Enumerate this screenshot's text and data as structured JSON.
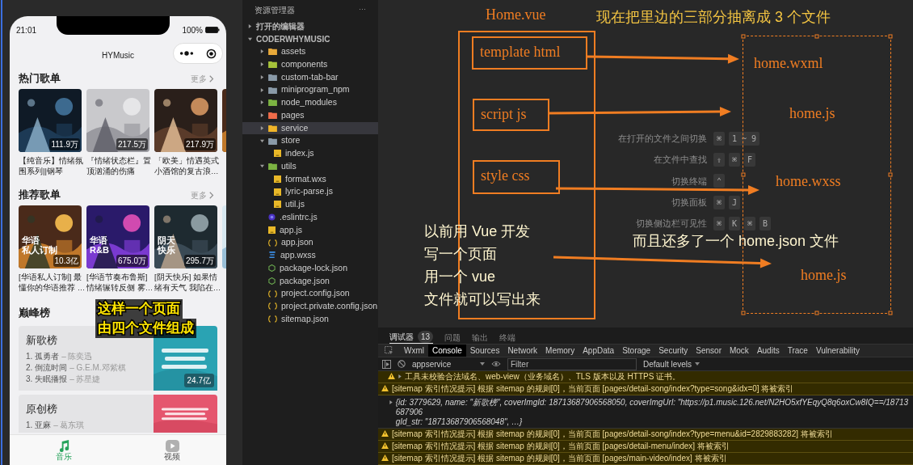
{
  "phone": {
    "time": "21:01",
    "battery": "100%",
    "title": "HYMusic",
    "hot": {
      "title": "热门歌单",
      "more": "更多",
      "items": [
        {
          "count": "111.9万",
          "name": [
            "【纯音乐】情绪氛",
            "围系列||钢琴"
          ]
        },
        {
          "count": "217.5万",
          "name": [
            "『情绪状态栏』置",
            "顶汹涌的伤痛"
          ]
        },
        {
          "count": "217.9万",
          "name": [
            "「欧美」情遇英式",
            "小酒馆的复古浪…"
          ]
        }
      ]
    },
    "recommend": {
      "title": "推荐歌单",
      "more": "更多",
      "items": [
        {
          "tag": [
            "华语",
            "私人订制"
          ],
          "count": "10.3亿",
          "name": [
            "[华语私人订制] 最",
            "懂你的华语推荐 …"
          ]
        },
        {
          "tag": [
            "华语",
            "R&B"
          ],
          "count": "675.0万",
          "name": [
            "[华语节奏布鲁斯]",
            "情绪辗转反侧 雾…"
          ]
        },
        {
          "tag": [
            "阴天",
            "快乐"
          ],
          "count": "295.7万",
          "name": [
            "[阴天快乐] 如果情",
            "绪有天气 我陷在…"
          ]
        }
      ]
    },
    "ranking_title": "巅峰榜",
    "rankings": [
      {
        "name": "新歌榜",
        "count": "24.7亿",
        "songs": [
          {
            "title": "1. 孤勇者",
            "artist": "– 陈奕迅"
          },
          {
            "title": "2. 倒流时间",
            "artist": "– G.E.M.邓紫棋"
          },
          {
            "title": "3. 失眠播报",
            "artist": "– 苏星婕"
          }
        ]
      },
      {
        "name": "原创榜",
        "songs": [
          {
            "title": "1. 亚麻",
            "artist": "– 葛东琪"
          }
        ]
      }
    ],
    "tabbar": [
      {
        "label": "音乐",
        "selected": true
      },
      {
        "label": "视频",
        "selected": false
      }
    ],
    "caption": [
      "这样一个页面",
      "由四个文件组成"
    ]
  },
  "explorer": {
    "title": "资源管理器",
    "menu": "···",
    "sections": [
      {
        "label": "打开的编辑器",
        "expanded": false
      },
      {
        "label": "CODERWHYMUSIC",
        "expanded": true,
        "children": [
          {
            "name": "assets",
            "kind": "folder",
            "color": "#e8a93a",
            "expanded": false,
            "selected": false
          },
          {
            "name": "components",
            "kind": "folder",
            "color": "#a6c23a",
            "expanded": false,
            "selected": false
          },
          {
            "name": "custom-tab-bar",
            "kind": "folder",
            "color": "#8a9aa8",
            "expanded": false,
            "selected": false
          },
          {
            "name": "miniprogram_npm",
            "kind": "folder",
            "color": "#8a9aa8",
            "expanded": false,
            "selected": false
          },
          {
            "name": "node_modules",
            "kind": "folder",
            "color": "#7cb342",
            "expanded": false,
            "selected": false
          },
          {
            "name": "pages",
            "kind": "folder",
            "color": "#ef6c4a",
            "expanded": false,
            "selected": false
          },
          {
            "name": "service",
            "kind": "folder",
            "color": "#f0b429",
            "expanded": false,
            "selected": true
          },
          {
            "name": "store",
            "kind": "folder",
            "color": "#8a9aa8",
            "expanded": true,
            "selected": false,
            "children": [
              {
                "name": "index.js",
                "kind": "js",
                "selected": false
              }
            ]
          },
          {
            "name": "utils",
            "kind": "folder",
            "color": "#7cb342",
            "expanded": true,
            "selected": false,
            "children": [
              {
                "name": "format.wxs",
                "kind": "js",
                "selected": false
              },
              {
                "name": "lyric-parse.js",
                "kind": "js",
                "selected": false
              },
              {
                "name": "util.js",
                "kind": "js",
                "selected": false
              }
            ]
          },
          {
            "name": ".eslintrc.js",
            "kind": "eslint",
            "selected": false
          },
          {
            "name": "app.js",
            "kind": "js",
            "selected": false
          },
          {
            "name": "app.json",
            "kind": "json",
            "selected": false
          },
          {
            "name": "app.wxss",
            "kind": "css",
            "selected": false
          },
          {
            "name": "package-lock.json",
            "kind": "npm",
            "selected": false
          },
          {
            "name": "package.json",
            "kind": "npm",
            "selected": false
          },
          {
            "name": "project.config.json",
            "kind": "json",
            "selected": false
          },
          {
            "name": "project.private.config.json",
            "kind": "json",
            "selected": false
          },
          {
            "name": "sitemap.json",
            "kind": "json",
            "selected": false
          }
        ]
      }
    ]
  },
  "canvas": {
    "file_title": "Home.vue",
    "heading": "现在把里边的三部分抽离成 3 个文件",
    "hints": [
      {
        "label": "在打开的文件之间切换",
        "keys": [
          "⌘",
          "1 ~ 9"
        ]
      },
      {
        "label": "在文件中查找",
        "keys": [
          "⇧",
          "⌘",
          "F"
        ]
      },
      {
        "label": "切换终端",
        "keys": [
          "⌃"
        ]
      },
      {
        "label": "切换面板",
        "keys": [
          "⌘",
          "J"
        ]
      },
      {
        "label": "切换侧边栏可见性",
        "keys": [
          "⌘",
          "K",
          "⌘",
          "B"
        ]
      }
    ],
    "sources": [
      "template html",
      "script js",
      "style css"
    ],
    "targets": [
      "home.wxml",
      "home.js",
      "home.wxss",
      "home.js"
    ],
    "note": [
      "以前用 Vue 开发",
      "写一个页面",
      "用一个 vue",
      "文件就可以写出来"
    ],
    "extra_note": "而且还多了一个 home.json 文件"
  },
  "console": {
    "panel_tabs": [
      {
        "label": "调试器",
        "badge": "13",
        "selected": true
      },
      {
        "label": "问题",
        "selected": false
      },
      {
        "label": "输出",
        "selected": false
      },
      {
        "label": "终端",
        "selected": false
      }
    ],
    "tools": [
      {
        "label": "Wxml",
        "selected": false
      },
      {
        "label": "Console",
        "selected": true
      },
      {
        "label": "Sources",
        "selected": false
      },
      {
        "label": "Network",
        "selected": false
      },
      {
        "label": "Memory",
        "selected": false
      },
      {
        "label": "AppData",
        "selected": false
      },
      {
        "label": "Storage",
        "selected": false
      },
      {
        "label": "Security",
        "selected": false
      },
      {
        "label": "Sensor",
        "selected": false
      },
      {
        "label": "Mock",
        "selected": false
      },
      {
        "label": "Audits",
        "selected": false
      },
      {
        "label": "Trace",
        "selected": false
      },
      {
        "label": "Vulnerability",
        "selected": false
      }
    ],
    "context": "appservice",
    "filter_placeholder": "Filter",
    "levels": "Default levels",
    "logs": [
      {
        "kind": "warning",
        "expandable": true,
        "lines": [
          "工具未校验合法域名、web-view（业务域名）、TLS 版本以及 HTTPS 证书。"
        ]
      },
      {
        "kind": "warning",
        "expandable": false,
        "lines": [
          "[sitemap 索引情况提示] 根据 sitemap 的规则[0]，当前页面 [pages/detail-song/index?type=song&idx=0] 将被索引"
        ]
      },
      {
        "kind": "object",
        "expandable": true,
        "lines": [
          "{id: 3779629, name: \"新歌榜\", coverImgId: 18713687906568050, coverImgUrl: \"https://p1.music.126.net/N2HO5xfYEqyQ8q6oxCw8IQ==/18713687906",
          "gId_str: \"18713687906568048\", …}"
        ]
      },
      {
        "kind": "warning",
        "expandable": false,
        "lines": [
          "[sitemap 索引情况提示] 根据 sitemap 的规则[0]，当前页面 [pages/detail-song/index?type=menu&id=2829883282] 将被索引"
        ]
      },
      {
        "kind": "warning",
        "expandable": false,
        "lines": [
          "[sitemap 索引情况提示] 根据 sitemap 的规则[0]，当前页面 [pages/detail-menu/index] 将被索引"
        ]
      },
      {
        "kind": "warning",
        "expandable": false,
        "lines": [
          "[sitemap 索引情况提示] 根据 sitemap 的规则[0]，当前页面 [pages/main-video/index] 将被索引"
        ]
      }
    ]
  }
}
